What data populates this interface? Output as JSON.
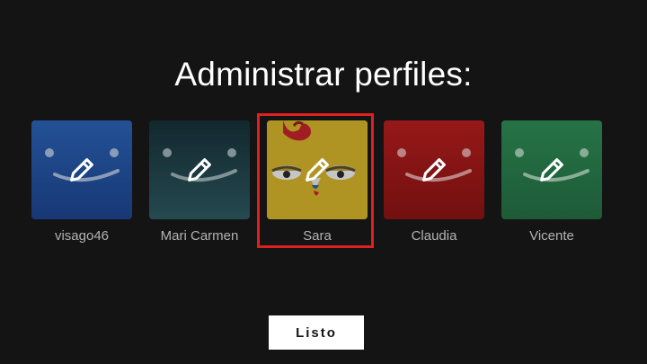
{
  "page": {
    "title": "Administrar perfiles:"
  },
  "profiles": [
    {
      "name": "visago46",
      "color_top": "#2a5fb0",
      "color_bottom": "#1f4a94",
      "avatar": "smiley-face"
    },
    {
      "name": "Mari Carmen",
      "color_top": "#1c3a44",
      "color_bottom": "#2f5d66",
      "avatar": "smiley-face"
    },
    {
      "name": "Sara",
      "color_top": "#d8b62a",
      "color_bottom": "#c9a21e",
      "avatar": "chicken-face",
      "selected": true
    },
    {
      "name": "Claudia",
      "color_top": "#b51d1d",
      "color_bottom": "#8f1515",
      "avatar": "smiley-face"
    },
    {
      "name": "Vicente",
      "color_top": "#2f8a55",
      "color_bottom": "#267447",
      "avatar": "smiley-face"
    }
  ],
  "actions": {
    "done_label": "Listo"
  },
  "colors": {
    "background": "#141414",
    "selection_border": "#e02020",
    "name_text": "#b3b3b3"
  },
  "icons": {
    "edit": "pencil-icon"
  }
}
